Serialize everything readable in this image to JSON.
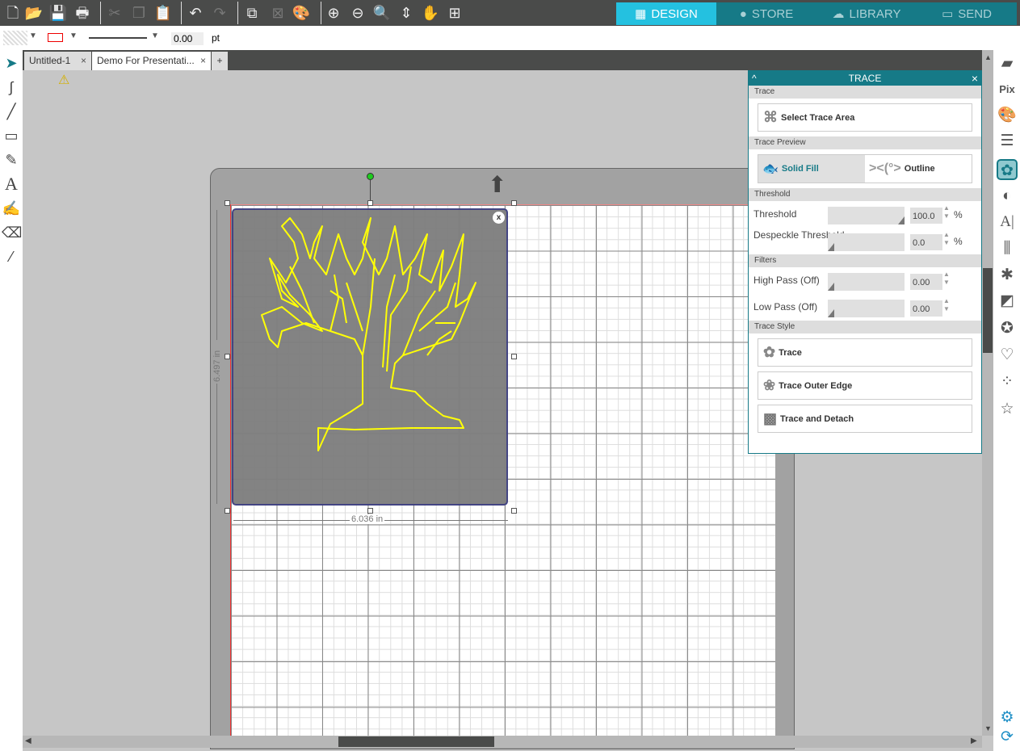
{
  "toolbar": {
    "icons": [
      "new-file-icon",
      "open-folder-icon",
      "save-icon",
      "print-icon",
      "cut-icon",
      "copy-icon",
      "paste-icon",
      "undo-icon",
      "redo-icon",
      "group-icon",
      "ungroup-icon",
      "fill-palette-icon",
      "zoom-in-icon",
      "zoom-out-icon",
      "zoom-select-icon",
      "pan-down-icon",
      "hand-icon",
      "fit-page-icon"
    ]
  },
  "nav": {
    "items": [
      {
        "label": "DESIGN",
        "active": true
      },
      {
        "label": "STORE"
      },
      {
        "label": "LIBRARY"
      },
      {
        "label": "SEND"
      }
    ]
  },
  "toolbar2": {
    "line_width": "0.00",
    "unit": "pt",
    "line_color": "#e00000"
  },
  "tabs": [
    {
      "label": "Untitled-1",
      "close": "×"
    },
    {
      "label": "Demo For Presentati...",
      "close": "×",
      "active": true
    }
  ],
  "tab_add": "+",
  "canvas": {
    "width_label": "6.036 in",
    "height_label": "6.497 in",
    "object_close": "x",
    "trace_color": "#ffff00"
  },
  "trace_panel": {
    "title": "TRACE",
    "collapse": "^",
    "close": "×",
    "sec_trace": "Trace",
    "select_area": "Select Trace Area",
    "sec_preview": "Trace Preview",
    "solid_fill": "Solid Fill",
    "outline": "Outline",
    "sec_threshold": "Threshold",
    "threshold": {
      "label": "Threshold",
      "value": "100.0",
      "unit": "%",
      "level": 100
    },
    "despeckle": {
      "label": "Despeckle Threshold",
      "value": "0.0",
      "unit": "%",
      "level": 0
    },
    "sec_filters": "Filters",
    "high_pass": {
      "label": "High Pass (Off)",
      "value": "0.00",
      "level": 0
    },
    "low_pass": {
      "label": "Low Pass (Off)",
      "value": "0.00",
      "level": 0
    },
    "sec_style": "Trace Style",
    "trace": "Trace",
    "trace_outer": "Trace Outer Edge",
    "trace_detach": "Trace and Detach"
  },
  "colors": {
    "accent": "#167a87",
    "active_nav": "#24c1e0"
  }
}
